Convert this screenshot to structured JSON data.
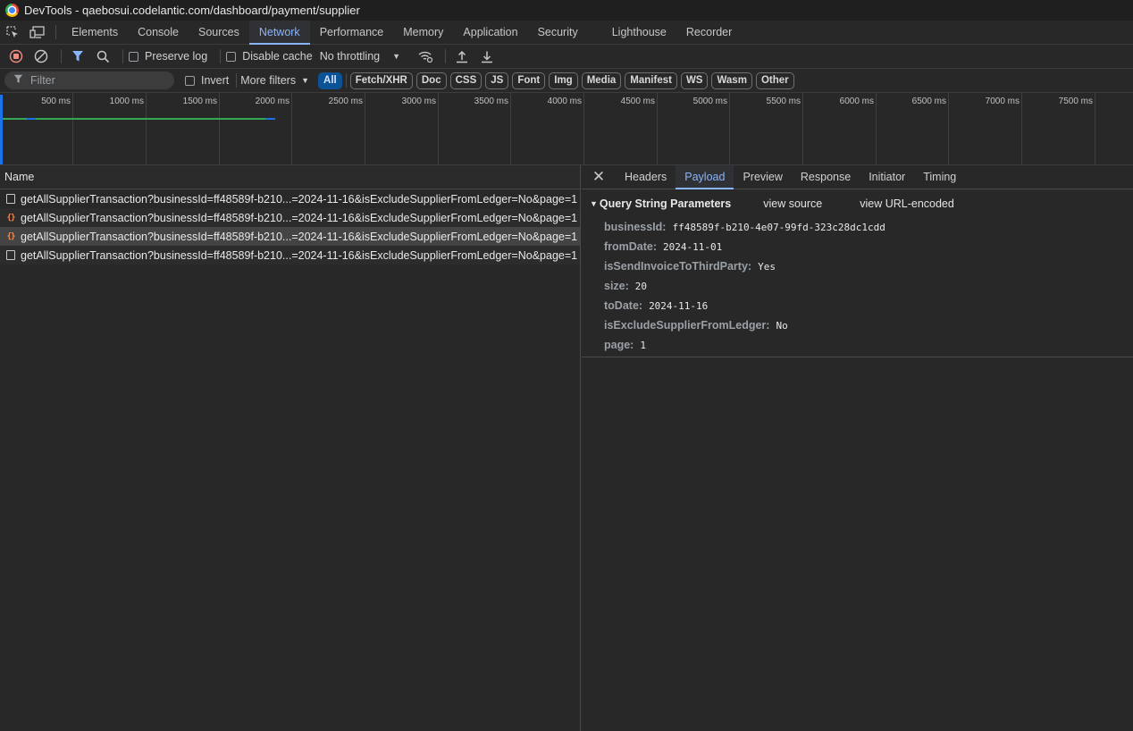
{
  "window": {
    "title": "DevTools - qaebosui.codelantic.com/dashboard/payment/supplier"
  },
  "tabs": [
    "Elements",
    "Console",
    "Sources",
    "Network",
    "Performance",
    "Memory",
    "Application",
    "Security",
    "Lighthouse",
    "Recorder"
  ],
  "active_tab": "Network",
  "toolbar": {
    "preserve_log": "Preserve log",
    "disable_cache": "Disable cache",
    "throttling": "No throttling"
  },
  "filterbar": {
    "placeholder": "Filter",
    "invert": "Invert",
    "more_filters": "More filters",
    "types": [
      "All",
      "Fetch/XHR",
      "Doc",
      "CSS",
      "JS",
      "Font",
      "Img",
      "Media",
      "Manifest",
      "WS",
      "Wasm",
      "Other"
    ],
    "active_type": "All"
  },
  "timeline": {
    "ticks": [
      "500 ms",
      "1000 ms",
      "1500 ms",
      "2000 ms",
      "2500 ms",
      "3000 ms",
      "3500 ms",
      "4000 ms",
      "4500 ms",
      "5000 ms",
      "5500 ms",
      "6000 ms",
      "6500 ms",
      "7000 ms",
      "7500 ms"
    ]
  },
  "requests": {
    "column": "Name",
    "rows": [
      {
        "name": "getAllSupplierTransaction?businessId=ff48589f-b210...=2024-11-16&isExcludeSupplierFromLedger=No&page=1",
        "icon": "document-icon"
      },
      {
        "name": "getAllSupplierTransaction?businessId=ff48589f-b210...=2024-11-16&isExcludeSupplierFromLedger=No&page=1",
        "icon": "json-icon"
      },
      {
        "name": "getAllSupplierTransaction?businessId=ff48589f-b210...=2024-11-16&isExcludeSupplierFromLedger=No&page=1",
        "icon": "json-icon"
      },
      {
        "name": "getAllSupplierTransaction?businessId=ff48589f-b210...=2024-11-16&isExcludeSupplierFromLedger=No&page=1",
        "icon": "document-icon"
      }
    ]
  },
  "detail": {
    "tabs": [
      "Headers",
      "Payload",
      "Preview",
      "Response",
      "Initiator",
      "Timing"
    ],
    "active_tab": "Payload",
    "section_title": "Query String Parameters",
    "view_source": "view source",
    "view_url_encoded": "view URL-encoded",
    "params": [
      {
        "name": "businessId:",
        "value": "ff48589f-b210-4e07-99fd-323c28dc1cdd"
      },
      {
        "name": "fromDate:",
        "value": "2024-11-01"
      },
      {
        "name": "isSendInvoiceToThirdParty:",
        "value": "Yes"
      },
      {
        "name": "size:",
        "value": "20"
      },
      {
        "name": "toDate:",
        "value": "2024-11-16"
      },
      {
        "name": "isExcludeSupplierFromLedger:",
        "value": "No"
      },
      {
        "name": "page:",
        "value": "1"
      }
    ]
  }
}
